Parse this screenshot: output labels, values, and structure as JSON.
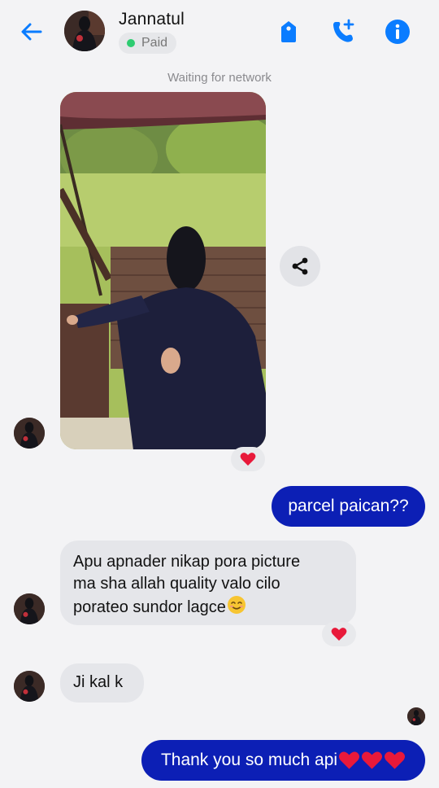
{
  "header": {
    "contact_name": "Jannatul",
    "status_badge": "Paid",
    "status_dot_color": "#2ecc71",
    "icons": [
      "back-arrow-icon",
      "tag-icon",
      "add-call-icon",
      "info-icon"
    ]
  },
  "conversation": {
    "network_status": "Waiting for network",
    "messages": [
      {
        "from": "contact",
        "type": "image",
        "reaction": "heart"
      },
      {
        "from": "me",
        "text": "parcel paican??"
      },
      {
        "from": "contact",
        "text_lines": [
          "Apu apnader nikap pora picture",
          "ma sha allah quality valo cilo",
          "porateo sundor lagce"
        ],
        "emoji": "smiling-face",
        "reaction": "heart"
      },
      {
        "from": "contact",
        "text": "Ji kal k"
      },
      {
        "from": "me",
        "text": "Thank you so much api",
        "emoji": "three-red-hearts"
      }
    ]
  },
  "colors": {
    "accent": "#0a7cff",
    "outgoing_bubble": "#0c1fb5",
    "incoming_bubble": "#e5e6ea",
    "heart": "#e8193a",
    "background": "#f3f3f5"
  }
}
